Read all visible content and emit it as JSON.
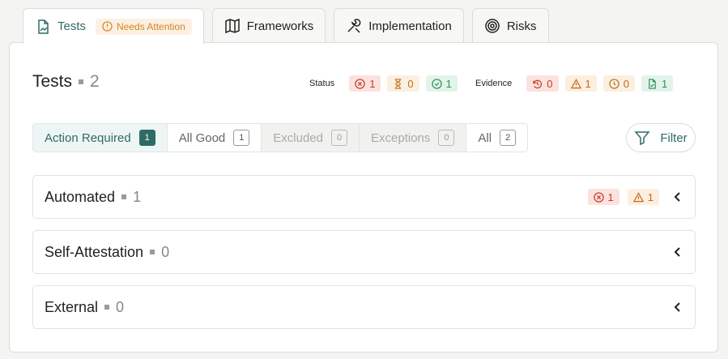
{
  "tabs": [
    {
      "label": "Tests",
      "icon": "document-chart-icon",
      "active": true
    },
    {
      "label": "Frameworks",
      "icon": "map-icon"
    },
    {
      "label": "Implementation",
      "icon": "wrench-icon"
    },
    {
      "label": "Risks",
      "icon": "target-icon"
    }
  ],
  "attention_badge": "Needs Attention",
  "header": {
    "title": "Tests",
    "count": "2"
  },
  "status": {
    "label": "Status",
    "failed": "1",
    "pending": "0",
    "passed": "1"
  },
  "evidence": {
    "label": "Evidence",
    "overdue": "0",
    "warning": "1",
    "due_soon": "0",
    "ok": "1"
  },
  "filters": [
    {
      "label": "Action Required",
      "count": "1"
    },
    {
      "label": "All Good",
      "count": "1"
    },
    {
      "label": "Excluded",
      "count": "0"
    },
    {
      "label": "Exceptions",
      "count": "0"
    },
    {
      "label": "All",
      "count": "2"
    }
  ],
  "filter_button": "Filter",
  "sections": [
    {
      "name": "Automated",
      "count": "1",
      "failed": "1",
      "warning": "1"
    },
    {
      "name": "Self-Attestation",
      "count": "0"
    },
    {
      "name": "External",
      "count": "0"
    }
  ],
  "colors": {
    "accent": "#2e6b67",
    "attention": "#d48623",
    "danger": "#c5382a",
    "success": "#2f8c5a"
  }
}
